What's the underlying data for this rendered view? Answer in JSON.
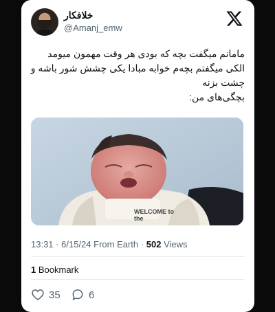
{
  "tweet": {
    "author": {
      "display_name": "خلافکار",
      "handle": "@Amanj_emw",
      "avatar_icon": "user-avatar"
    },
    "logo_icon": "x-logo-icon",
    "text_lines": [
      "مامانم میگفت بچه که بودی هر وقت مهمون میومد",
      "الکی میگفتم بچه‌م خوابه مبادا یکی چشش شور باشه و",
      "چشت بزنه",
      "بچگی‌های من:"
    ],
    "media": {
      "caption_on_shirt": "WELCOME to the"
    },
    "meta": {
      "time": "13:31",
      "separator": "·",
      "date": "6/15/24",
      "source": "From Earth",
      "views_count": "502",
      "views_label": "Views"
    },
    "bookmarks": {
      "count": "1",
      "label": "Bookmark"
    },
    "actions": {
      "likes": "35",
      "replies": "6",
      "like_icon": "heart-icon",
      "reply_icon": "reply-bubble-icon"
    }
  },
  "colors": {
    "page_background": "#0a0a0a",
    "card_background": "#ffffff",
    "primary_text": "#0f1419",
    "secondary_text": "#536471"
  }
}
